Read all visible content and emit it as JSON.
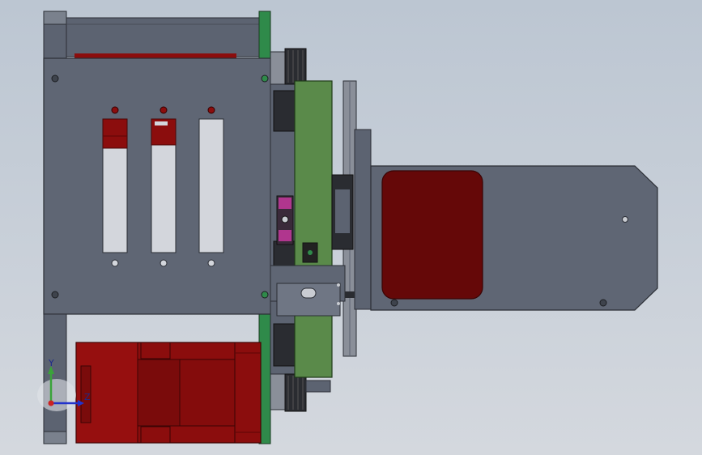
{
  "viewport": {
    "background_top": "#bcc6d2",
    "background_bottom": "#d4d8de"
  },
  "colors": {
    "plate": "#5c6371",
    "plate_dark": "#3e434c",
    "plate_light": "#6f7684",
    "motor_red": "#8b0d0d",
    "motor_red_dark": "#5d0505",
    "pcb_green": "#5a8a4a",
    "pcb_green_dark": "#2f6b3a",
    "magenta": "#b0368e",
    "hole": "#c9ccd2"
  },
  "triad": {
    "y_label": "Y",
    "z_label": "Z",
    "x_icon": "red-dot",
    "y_color": "#3aa33a",
    "z_color": "#2233cc",
    "x_color": "#cc2222"
  },
  "slots": [
    {
      "name": "slot-1",
      "red_fill": 0.17
    },
    {
      "name": "slot-2",
      "red_fill": 0.16
    },
    {
      "name": "slot-3",
      "red_fill": 0.0
    }
  ]
}
